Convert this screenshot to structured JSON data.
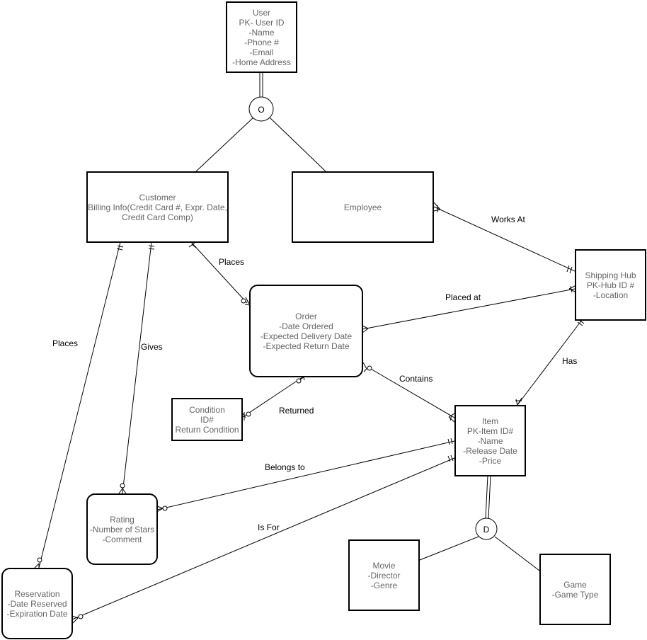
{
  "entities": {
    "user": "User\nPK- User ID\n-Name\n-Phone #\n-Email\n-Home Address",
    "customer": "Customer\nBilling Info(Credit Card #, Expr. Date,\nCredit Card Comp)",
    "employee": "Employee",
    "shipping_hub": "Shipping Hub\nPK-Hub ID #\n-Location",
    "order": "Order\n-Date Ordered\n-Expected Delivery Date\n-Expected Return Date",
    "condition": "Condition\nID#\nReturn Condition",
    "item": "Item\nPK-Item ID#\n-Name\n-Release Date\n-Price",
    "rating": "Rating\n-Number of Stars\n-Comment",
    "reservation": "Reservation\n-Date Reserved\n-Expiration Date",
    "movie": "Movie\n-Director\n-Genre",
    "game": "Game\n-Game Type"
  },
  "specializations": {
    "user_overlap": "O",
    "item_disjoint": "D"
  },
  "relationships": {
    "works_at": "Works At",
    "customer_places_order": "Places",
    "placed_at": "Placed at",
    "has": "Has",
    "contains": "Contains",
    "returned": "Returned",
    "customer_places_reservation": "Places",
    "gives": "Gives",
    "belongs_to": "Belongs to",
    "is_for": "Is For"
  }
}
